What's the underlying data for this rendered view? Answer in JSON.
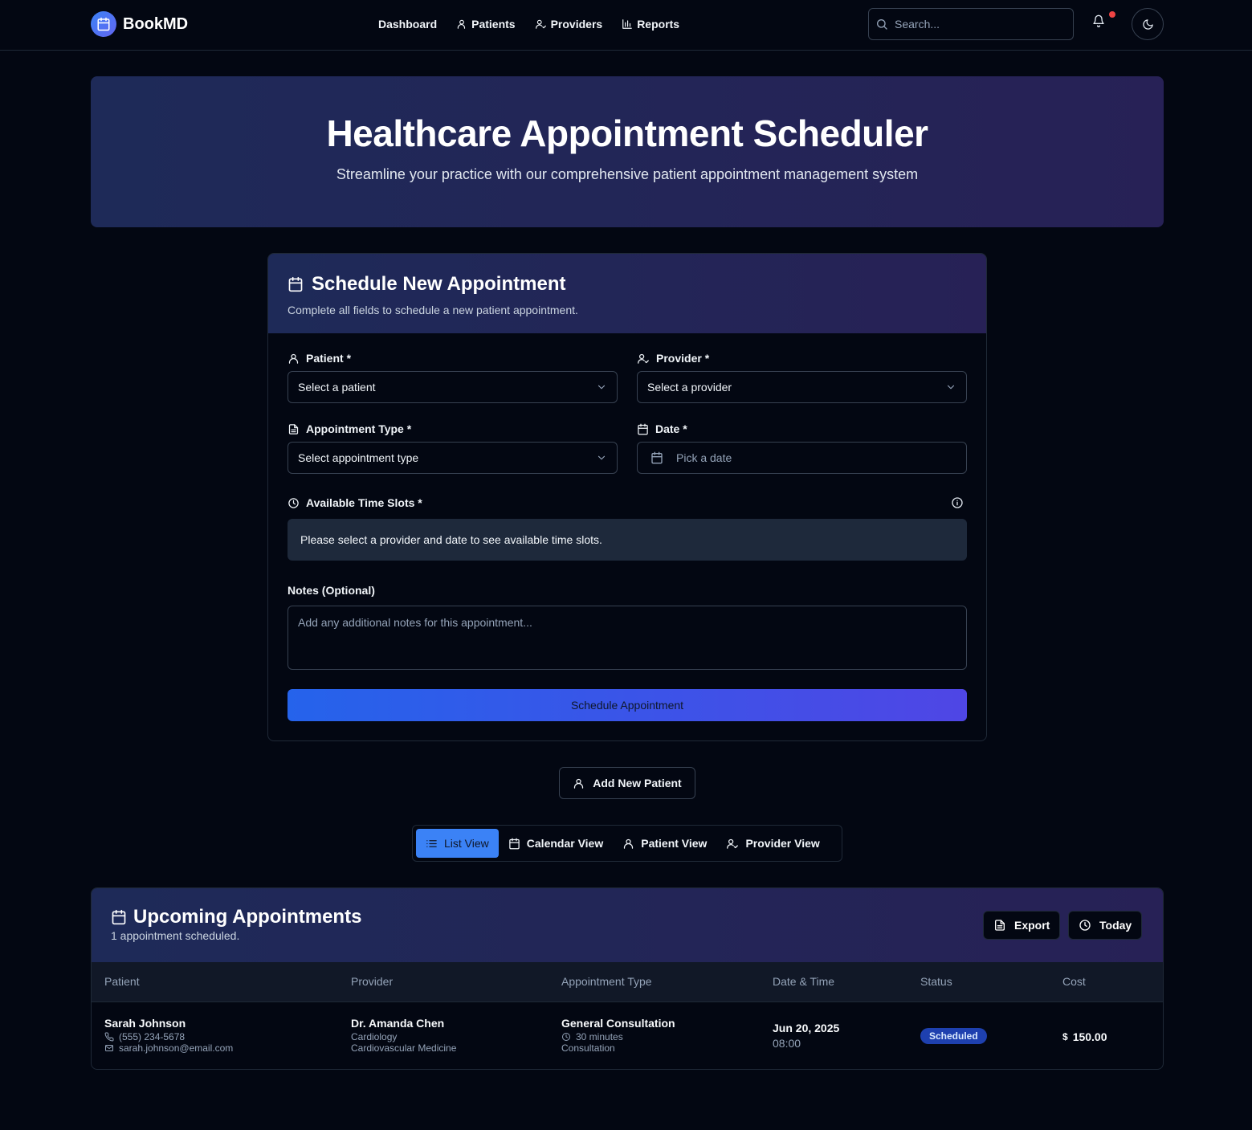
{
  "app": {
    "name": "BookMD"
  },
  "nav": {
    "items": [
      {
        "label": "Dashboard",
        "icon": ""
      },
      {
        "label": "Patients",
        "icon": "user-icon"
      },
      {
        "label": "Providers",
        "icon": "user-check-icon"
      },
      {
        "label": "Reports",
        "icon": "bar-chart-icon"
      }
    ],
    "search_placeholder": "Search..."
  },
  "hero": {
    "title": "Healthcare Appointment Scheduler",
    "subtitle": "Streamline your practice with our comprehensive patient appointment management system"
  },
  "form": {
    "title": "Schedule New Appointment",
    "subtitle": "Complete all fields to schedule a new patient appointment.",
    "patient_label": "Patient *",
    "patient_value": "Select a patient",
    "provider_label": "Provider *",
    "provider_value": "Select a provider",
    "type_label": "Appointment Type *",
    "type_value": "Select appointment type",
    "date_label": "Date *",
    "date_placeholder": "Pick a date",
    "slots_label": "Available Time Slots *",
    "slots_note": "Please select a provider and date to see available time slots.",
    "notes_label": "Notes (Optional)",
    "notes_placeholder": "Add any additional notes for this appointment...",
    "submit_label": "Schedule Appointment"
  },
  "add_patient_label": "Add New Patient",
  "view_tabs": [
    {
      "label": "List View",
      "active": true
    },
    {
      "label": "Calendar View",
      "active": false
    },
    {
      "label": "Patient View",
      "active": false
    },
    {
      "label": "Provider View",
      "active": false
    }
  ],
  "appointments": {
    "title": "Upcoming Appointments",
    "subtitle": "1 appointment scheduled.",
    "export_label": "Export",
    "today_label": "Today",
    "columns": [
      "Patient",
      "Provider",
      "Appointment Type",
      "Date & Time",
      "Status",
      "Cost"
    ],
    "rows": [
      {
        "patient_name": "Sarah Johnson",
        "patient_phone": "(555) 234-5678",
        "patient_email": "sarah.johnson@email.com",
        "provider_name": "Dr. Amanda Chen",
        "provider_dept": "Cardiology",
        "provider_specialty": "Cardiovascular Medicine",
        "type_name": "General Consultation",
        "type_duration": "30 minutes",
        "type_category": "Consultation",
        "date": "Jun 20, 2025",
        "time": "08:00",
        "status": "Scheduled",
        "cost": "150.00",
        "currency": "$"
      }
    ]
  },
  "colors": {
    "accent": "#3b82f6",
    "background": "#030712",
    "notification_dot": "#ef4444",
    "status_badge": "#1e40af"
  }
}
